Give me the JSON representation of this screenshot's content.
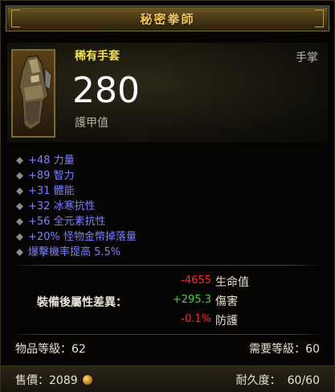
{
  "title": "秘密拳師",
  "item": {
    "name": "稀有手套",
    "slot": "手掌",
    "armor_value": "280",
    "armor_label": "護甲值"
  },
  "affixes": [
    "+48 力量",
    "+89 智力",
    "+31 體能",
    "+32 冰寒抗性",
    "+56 全元素抗性",
    "+20% 怪物金幣掉落量",
    "爆擊機率提高 5.5%"
  ],
  "comparison": {
    "label": "裝備後屬性差異：",
    "rows": [
      {
        "value": "-4655",
        "stat": "生命值",
        "color": "#f02f2f"
      },
      {
        "value": "+295.3",
        "stat": "傷害",
        "color": "#47d43a"
      },
      {
        "value": "-0.1%",
        "stat": "防護",
        "color": "#f02f2f"
      }
    ]
  },
  "item_level": "物品等級：62",
  "required_level": "需要等級：60",
  "price": {
    "label": "售價：",
    "amount": "2089"
  },
  "durability": {
    "label": "耐久度：",
    "value": "60/60"
  },
  "colors": {
    "title": "#f2c65a",
    "item_name": "#f5e14a",
    "affix": "#7b80ff"
  },
  "icons": {
    "item": "gloves-icon",
    "bullet": "diamond-bullet-icon",
    "currency": "gold-coin-icon"
  }
}
